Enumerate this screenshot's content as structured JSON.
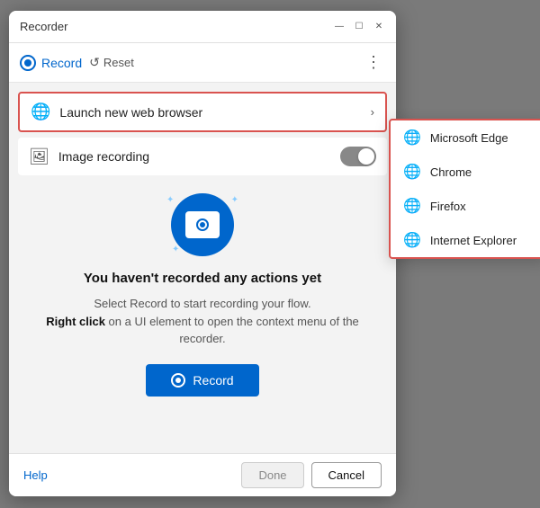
{
  "window": {
    "title": "Recorder",
    "controls": {
      "minimize": "—",
      "maximize": "☐",
      "close": "✕"
    }
  },
  "toolbar": {
    "record_label": "Record",
    "reset_label": "Reset",
    "more_icon": "⋮"
  },
  "browser_row": {
    "label": "Launch new web browser",
    "chevron": "›"
  },
  "image_row": {
    "label": "Image recording"
  },
  "hero": {
    "title": "You haven't recorded any actions yet",
    "desc_normal": "Select Record to start recording your flow.",
    "desc_bold": "Right click",
    "desc_after": " on a UI element to open the context menu of the recorder.",
    "record_button": "Record"
  },
  "footer": {
    "help_label": "Help",
    "done_label": "Done",
    "cancel_label": "Cancel"
  },
  "dropdown": {
    "items": [
      {
        "label": "Microsoft Edge"
      },
      {
        "label": "Chrome"
      },
      {
        "label": "Firefox"
      },
      {
        "label": "Internet Explorer"
      }
    ]
  }
}
